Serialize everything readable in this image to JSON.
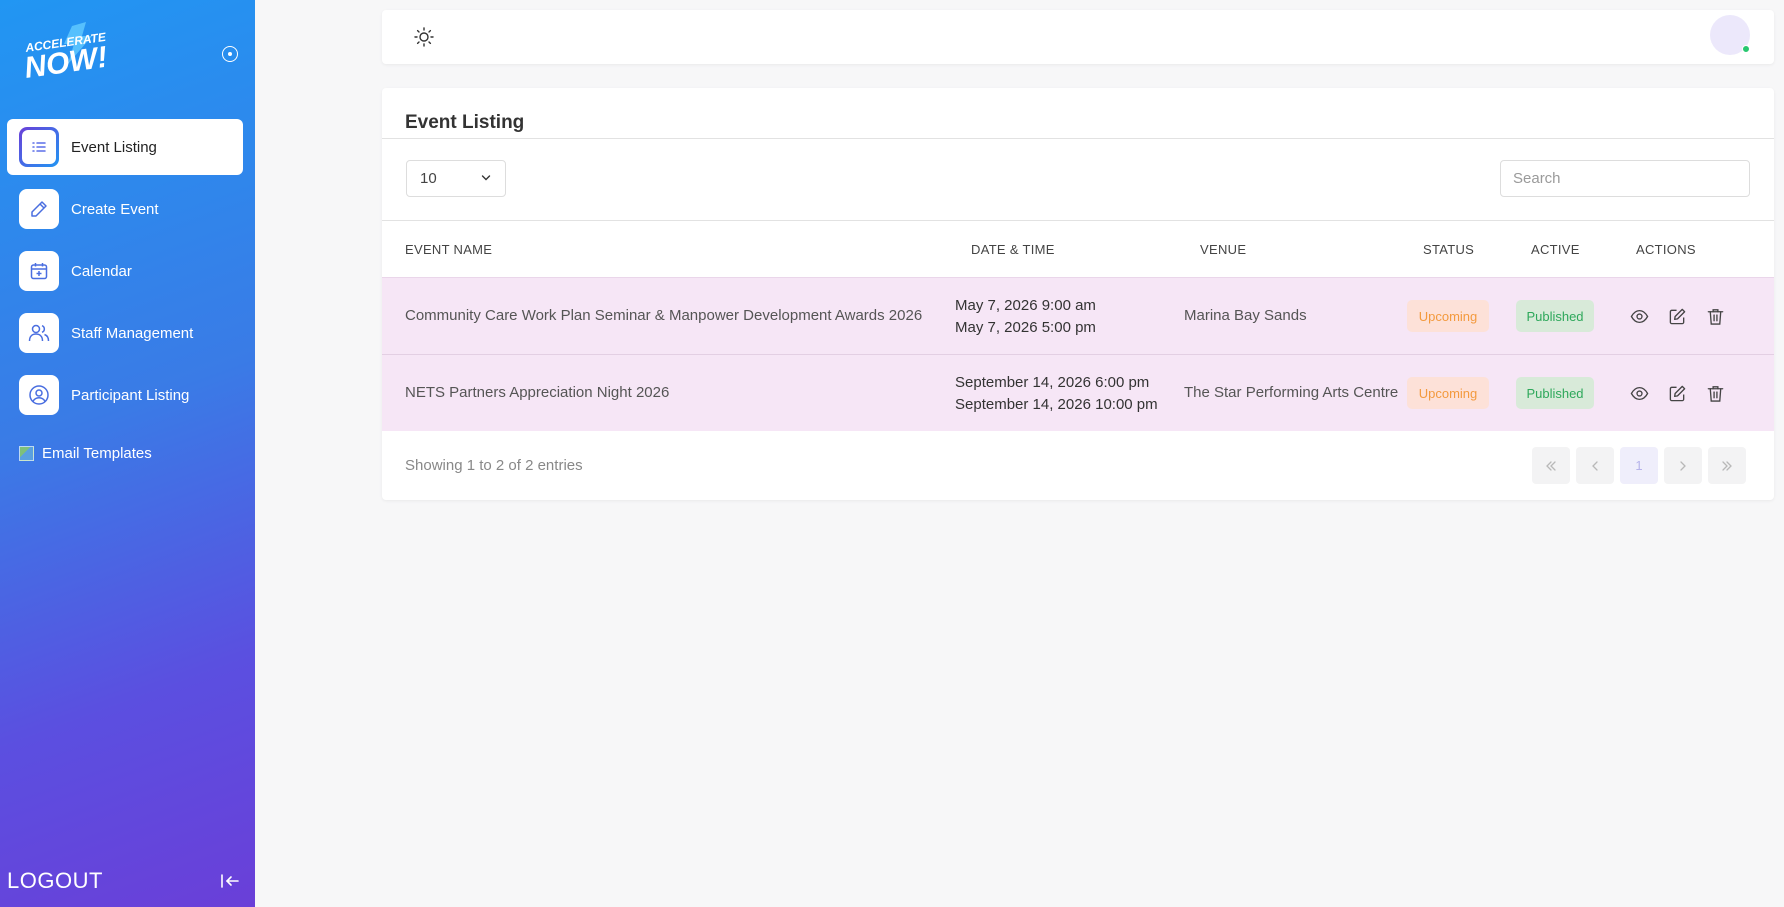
{
  "sidebar": {
    "logo_text_top": "ACCELERATE",
    "logo_text_main": "NOW!",
    "items": [
      {
        "label": "Event Listing",
        "icon": "list-icon",
        "active": true
      },
      {
        "label": "Create Event",
        "icon": "pencil-icon",
        "active": false
      },
      {
        "label": "Calendar",
        "icon": "calendar-icon",
        "active": false
      },
      {
        "label": "Staff Management",
        "icon": "users-icon",
        "active": false
      },
      {
        "label": "Participant Listing",
        "icon": "user-circle-icon",
        "active": false
      },
      {
        "label": "Email Templates",
        "icon": "broken-image-icon",
        "active": false
      }
    ],
    "logout_label": "LOGOUT"
  },
  "topbar": {
    "theme_icon": "sun-icon",
    "avatar_status": "online"
  },
  "main": {
    "title": "Event Listing",
    "page_size": "10",
    "search_placeholder": "Search",
    "columns": [
      "EVENT NAME",
      "DATE & TIME",
      "VENUE",
      "STATUS",
      "ACTIVE",
      "ACTIONS"
    ],
    "rows": [
      {
        "name": "Community Care Work Plan Seminar & Manpower Development Awards 2026",
        "start": "May 7, 2026 9:00 am",
        "end": "May 7, 2026 5:00 pm",
        "venue": "Marina Bay Sands",
        "status": "Upcoming",
        "active": "Published"
      },
      {
        "name": "NETS Partners Appreciation Night 2026",
        "start": "September 14, 2026 6:00 pm",
        "end": "September 14, 2026 10:00 pm",
        "venue": "The Star Performing Arts Centre",
        "status": "Upcoming",
        "active": "Published"
      }
    ],
    "showing_text": "Showing 1 to 2 of 2 entries",
    "pagination": {
      "current_page": "1"
    }
  },
  "colors": {
    "sidebar_gradient_start": "#2196f3",
    "sidebar_gradient_end": "#6a3fd8",
    "row_bg": "#f6e6f6",
    "status_bg": "#fde1d8",
    "status_text": "#f39a3e",
    "active_bg": "#d8ead9",
    "active_text": "#2ea85b"
  }
}
